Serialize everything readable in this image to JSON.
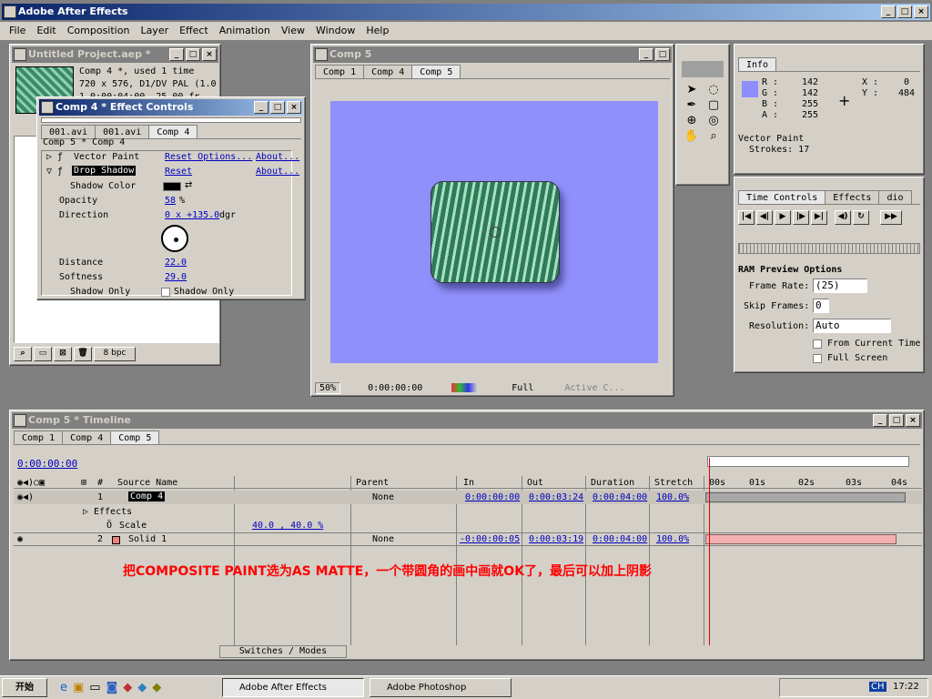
{
  "app": {
    "title": "Adobe After Effects"
  },
  "menu": [
    "File",
    "Edit",
    "Composition",
    "Layer",
    "Effect",
    "Animation",
    "View",
    "Window",
    "Help"
  ],
  "project": {
    "title": "Untitled Project.aep *",
    "info1": "Comp 4 *, used 1 time",
    "info2": "720 x 576, D1/DV PAL (1.0",
    "info3": "1 0:00:04:00, 25.00 fr",
    "bpc": "8 bpc"
  },
  "effects": {
    "title": "Comp 4 * Effect Controls",
    "tabs": [
      "001.avi",
      "001.avi",
      "Comp 4"
    ],
    "header": "Comp 5 * Comp 4",
    "vp_label": "Vector Paint",
    "vp_reset": "Reset Options...",
    "vp_about": "About...",
    "ds_label": "Drop Shadow",
    "ds_reset": "Reset",
    "ds_about": "About...",
    "shadow_color": "Shadow Color",
    "opacity": "Opacity",
    "opacity_val": "58",
    "opacity_unit": "%",
    "direction": "Direction",
    "dir_val": "0 x +135.0",
    "dir_unit": "dgr",
    "distance": "Distance",
    "distance_val": "22.0",
    "softness": "Softness",
    "softness_val": "29.0",
    "shadow_only": "Shadow Only",
    "shadow_only_cb": "Shadow Only"
  },
  "comp": {
    "title": "Comp 5",
    "tabs": [
      "Comp 1",
      "Comp 4",
      "Comp 5"
    ],
    "zoom": "50%",
    "time": "0:00:00:00",
    "res": "Full",
    "view": "Active C..."
  },
  "info": {
    "title": "Info",
    "r": "142",
    "g": "142",
    "b": "255",
    "a": "255",
    "x": "0",
    "y": "484",
    "rl": "R :",
    "gl": "G :",
    "bl": "B :",
    "al": "A :",
    "xl": "X :",
    "yl": "Y :",
    "line1": "Vector Paint",
    "line2": "Strokes: 17"
  },
  "timecontrols": {
    "tabs": [
      "Time Controls",
      "Effects",
      "dio"
    ],
    "ram": "RAM Preview Options",
    "fr_label": "Frame Rate:",
    "fr": "(25)",
    "skip_label": "Skip Frames:",
    "skip": "0",
    "res_label": "Resolution:",
    "res": "Auto",
    "from": "From Current Time",
    "full": "Full Screen"
  },
  "timeline": {
    "title": "Comp 5 * Timeline",
    "tabs": [
      "Comp 1",
      "Comp 4",
      "Comp 5"
    ],
    "time": "0:00:00:00",
    "cols": {
      "num": "#",
      "src": "Source Name",
      "parent": "Parent",
      "in": "In",
      "out": "Out",
      "dur": "Duration",
      "stretch": "Stretch"
    },
    "ticks": [
      "00s",
      "01s",
      "02s",
      "03s",
      "04s"
    ],
    "layers": [
      {
        "num": "1",
        "name": "Comp 4",
        "parent": "None",
        "in": "0:00:00:00",
        "out": "0:00:03:24",
        "dur": "0:00:04:00",
        "stretch": "100.0%"
      },
      {
        "num": "2",
        "name": "Solid 1",
        "parent": "None",
        "in": "-0:00:00:05",
        "out": "0:00:03:19",
        "dur": "0:00:04:00",
        "stretch": "100.0%"
      }
    ],
    "effects_row": "Effects",
    "scale_row": "Scale",
    "scale_val": "40.0 , 40.0 %",
    "annotation": "把COMPOSITE PAINT选为AS MATTE，一个带圆角的画中画就OK了，最后可以加上阴影",
    "switches": "Switches / Modes"
  },
  "taskbar": {
    "start": "开始",
    "items": [
      "Adobe After Effects",
      "Adobe Photoshop"
    ],
    "time": "17:22",
    "lang": "CH"
  }
}
